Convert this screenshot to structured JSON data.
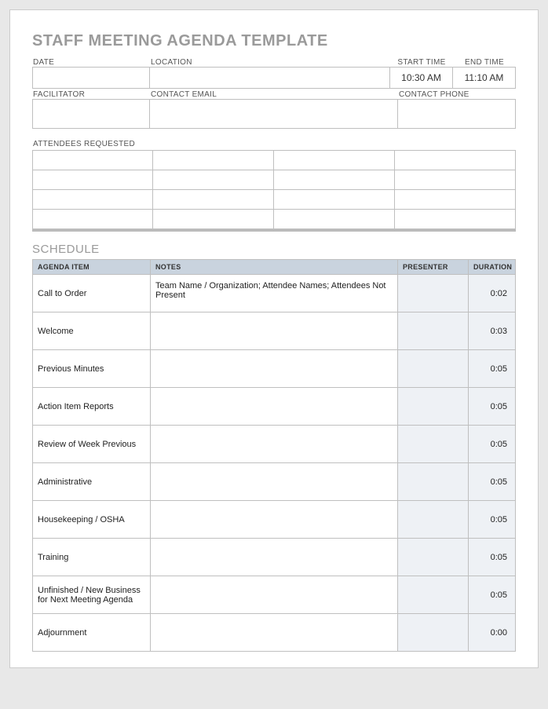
{
  "title": "STAFF MEETING AGENDA TEMPLATE",
  "labels": {
    "date": "DATE",
    "location": "LOCATION",
    "start_time": "START TIME",
    "end_time": "END TIME",
    "facilitator": "FACILITATOR",
    "contact_email": "CONTACT EMAIL",
    "contact_phone": "CONTACT PHONE",
    "attendees": "ATTENDEES REQUESTED",
    "schedule": "SCHEDULE"
  },
  "values": {
    "date": "",
    "location": "",
    "start_time": "10:30 AM",
    "end_time": "11:10 AM",
    "facilitator": "",
    "contact_email": "",
    "contact_phone": ""
  },
  "schedule": {
    "headers": {
      "item": "AGENDA ITEM",
      "notes": "NOTES",
      "presenter": "PRESENTER",
      "duration": "DURATION"
    },
    "rows": [
      {
        "item": "Call to Order",
        "notes": "Team Name / Organization; Attendee Names; Attendees Not Present",
        "presenter": "",
        "duration": "0:02"
      },
      {
        "item": "Welcome",
        "notes": "",
        "presenter": "",
        "duration": "0:03"
      },
      {
        "item": "Previous Minutes",
        "notes": "",
        "presenter": "",
        "duration": "0:05"
      },
      {
        "item": "Action Item Reports",
        "notes": "",
        "presenter": "",
        "duration": "0:05"
      },
      {
        "item": "Review of Week Previous",
        "notes": "",
        "presenter": "",
        "duration": "0:05"
      },
      {
        "item": "Administrative",
        "notes": "",
        "presenter": "",
        "duration": "0:05"
      },
      {
        "item": "Housekeeping / OSHA",
        "notes": "",
        "presenter": "",
        "duration": "0:05"
      },
      {
        "item": "Training",
        "notes": "",
        "presenter": "",
        "duration": "0:05"
      },
      {
        "item": "Unfinished / New Business for Next Meeting Agenda",
        "notes": "",
        "presenter": "",
        "duration": "0:05"
      },
      {
        "item": "Adjournment",
        "notes": "",
        "presenter": "",
        "duration": "0:00"
      }
    ]
  }
}
